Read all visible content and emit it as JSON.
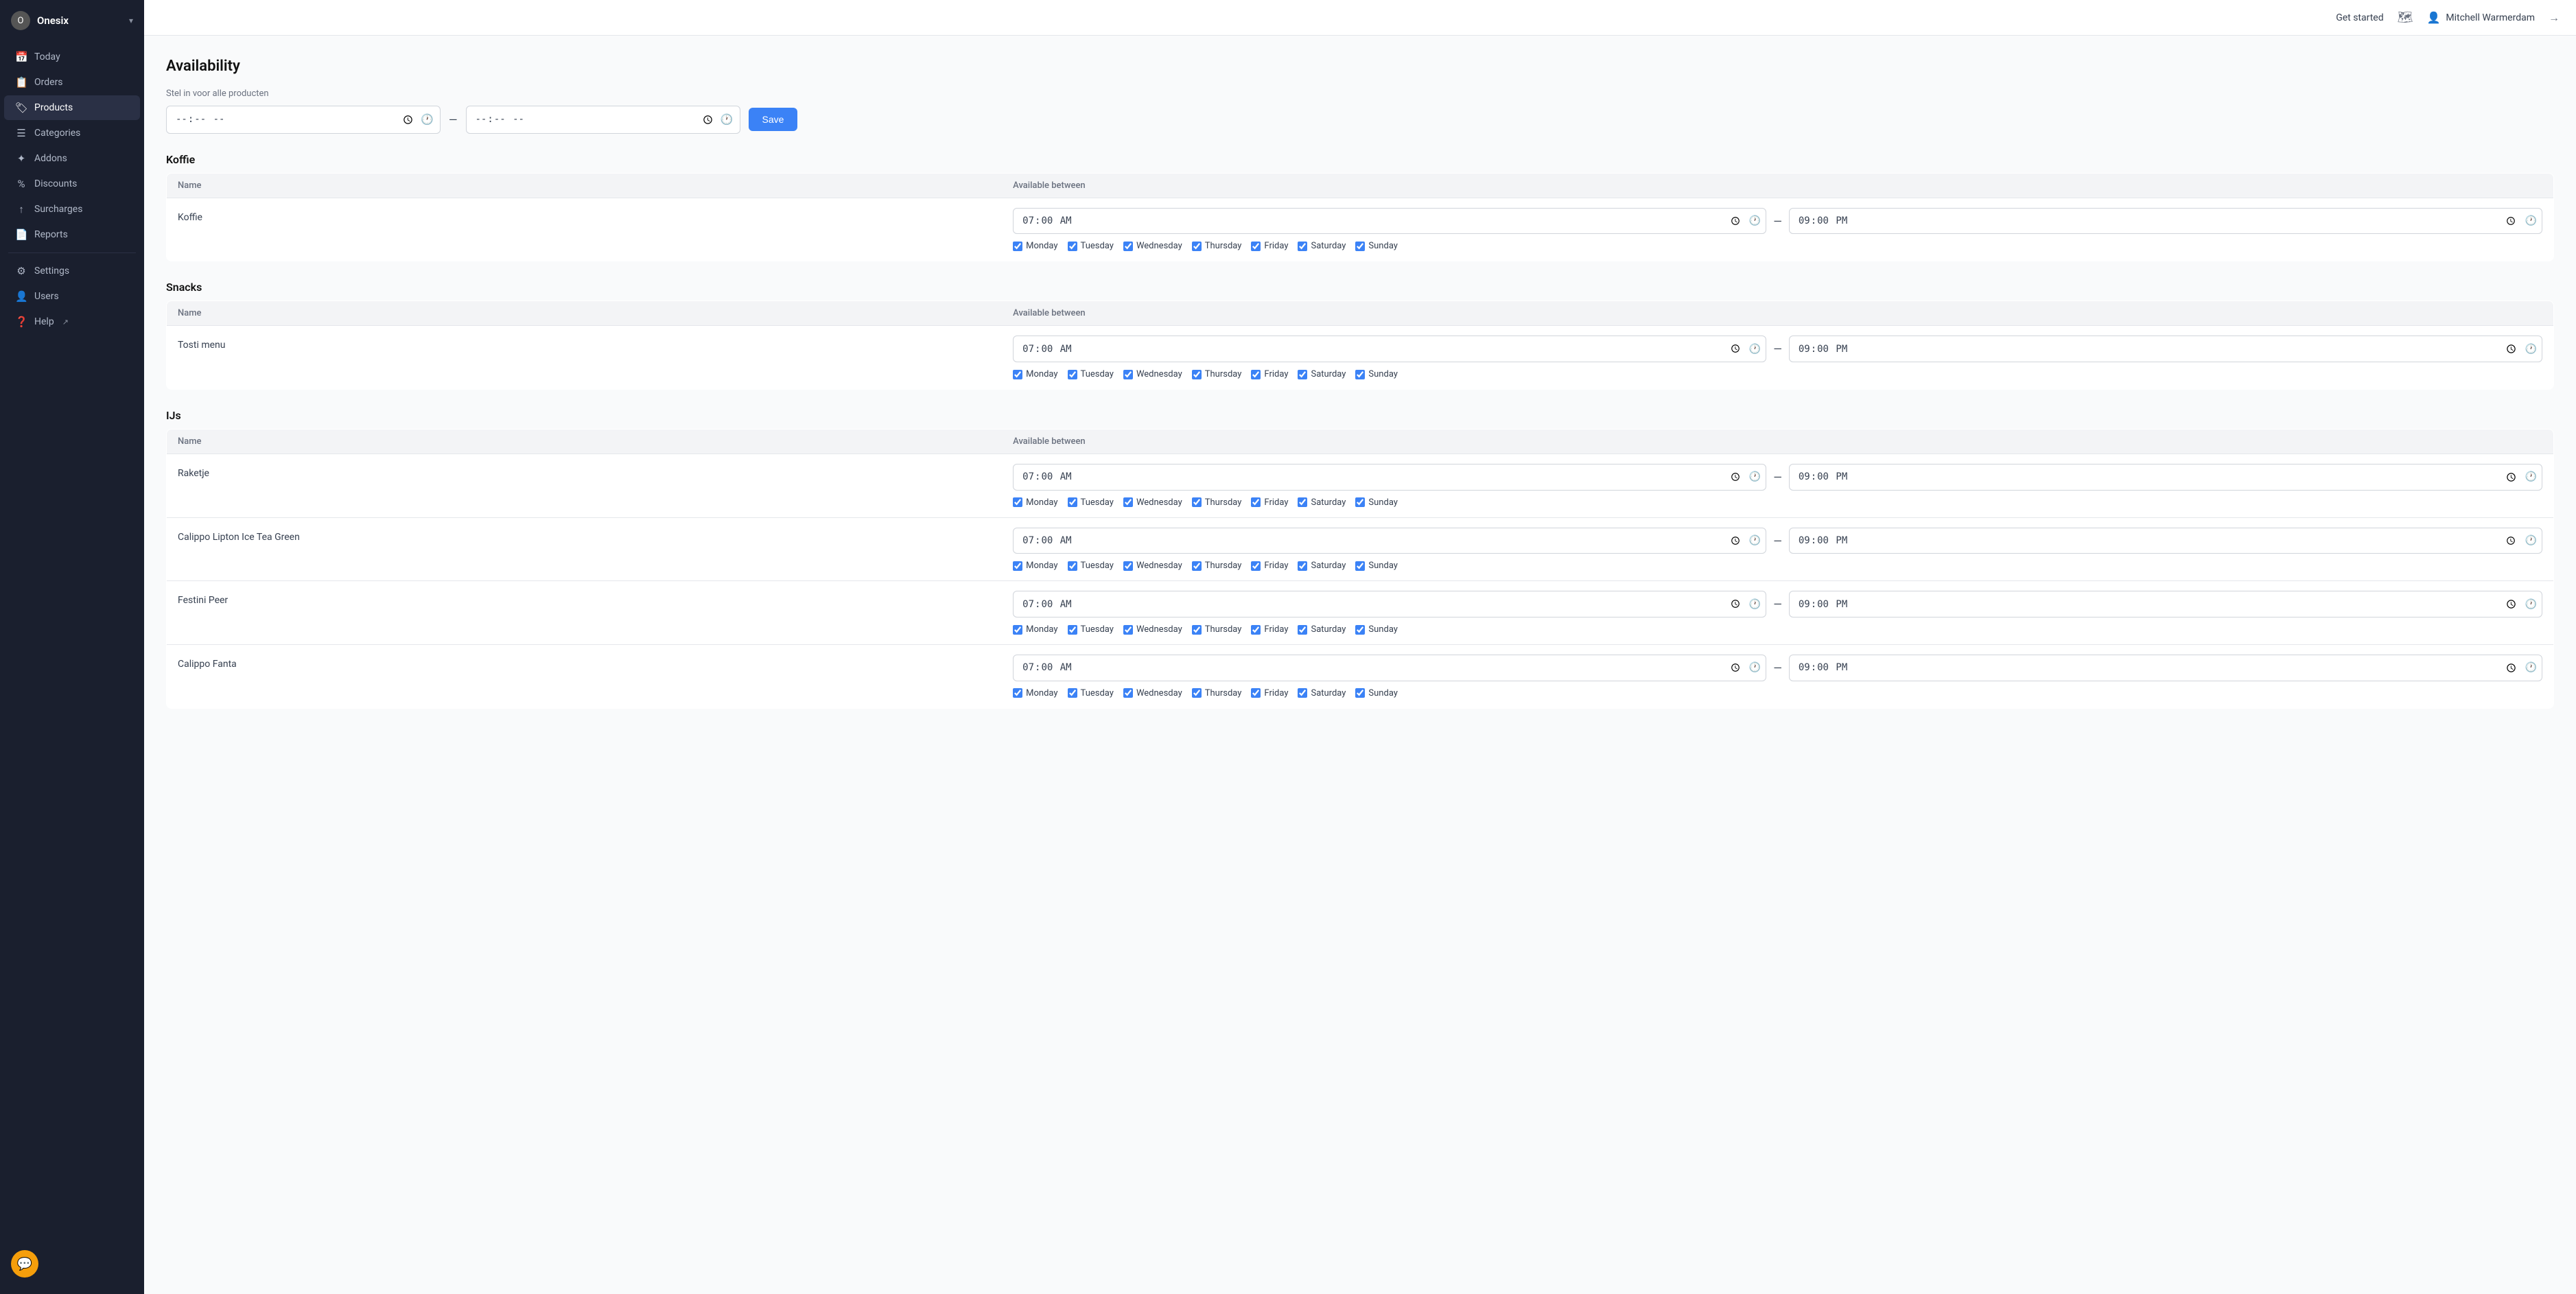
{
  "sidebar": {
    "brand": "Onesix",
    "chevron": "▾",
    "items": [
      {
        "id": "today",
        "label": "Today",
        "icon": "📅",
        "active": false
      },
      {
        "id": "orders",
        "label": "Orders",
        "icon": "📋",
        "active": false
      },
      {
        "id": "products",
        "label": "Products",
        "icon": "🏷",
        "active": true
      },
      {
        "id": "categories",
        "label": "Categories",
        "icon": "≡",
        "active": false
      },
      {
        "id": "addons",
        "label": "Addons",
        "icon": "✦",
        "active": false
      },
      {
        "id": "discounts",
        "label": "Discounts",
        "icon": "%",
        "active": false
      },
      {
        "id": "surcharges",
        "label": "Surcharges",
        "icon": "↑",
        "active": false
      },
      {
        "id": "reports",
        "label": "Reports",
        "icon": "📄",
        "active": false
      }
    ],
    "bottom_items": [
      {
        "id": "settings",
        "label": "Settings",
        "icon": "⚙"
      },
      {
        "id": "users",
        "label": "Users",
        "icon": "👤"
      },
      {
        "id": "help",
        "label": "Help",
        "icon": "❓"
      }
    ]
  },
  "topbar": {
    "get_started": "Get started",
    "user_name": "Mitchell Warmerdam"
  },
  "page": {
    "title": "Availability",
    "global_label": "Stel in voor alle producten",
    "global_start": "",
    "global_end": "",
    "save_label": "Save",
    "col_name": "Name",
    "col_available_between": "Available between"
  },
  "days": [
    "Monday",
    "Tuesday",
    "Wednesday",
    "Thursday",
    "Friday",
    "Saturday",
    "Sunday"
  ],
  "categories": [
    {
      "name": "Koffie",
      "products": [
        {
          "name": "Koffie",
          "start": "07:00",
          "end": "21:00"
        }
      ]
    },
    {
      "name": "Snacks",
      "products": [
        {
          "name": "Tosti menu",
          "start": "07:00",
          "end": "21:00"
        }
      ]
    },
    {
      "name": "IJs",
      "products": [
        {
          "name": "Raketje",
          "start": "07:00",
          "end": "21:00"
        },
        {
          "name": "Calippo Lipton Ice Tea Green",
          "start": "07:00",
          "end": "21:00"
        },
        {
          "name": "Festini Peer",
          "start": "07:00",
          "end": "21:00"
        },
        {
          "name": "Calippo Fanta",
          "start": "07:00",
          "end": "21:00"
        }
      ]
    }
  ]
}
